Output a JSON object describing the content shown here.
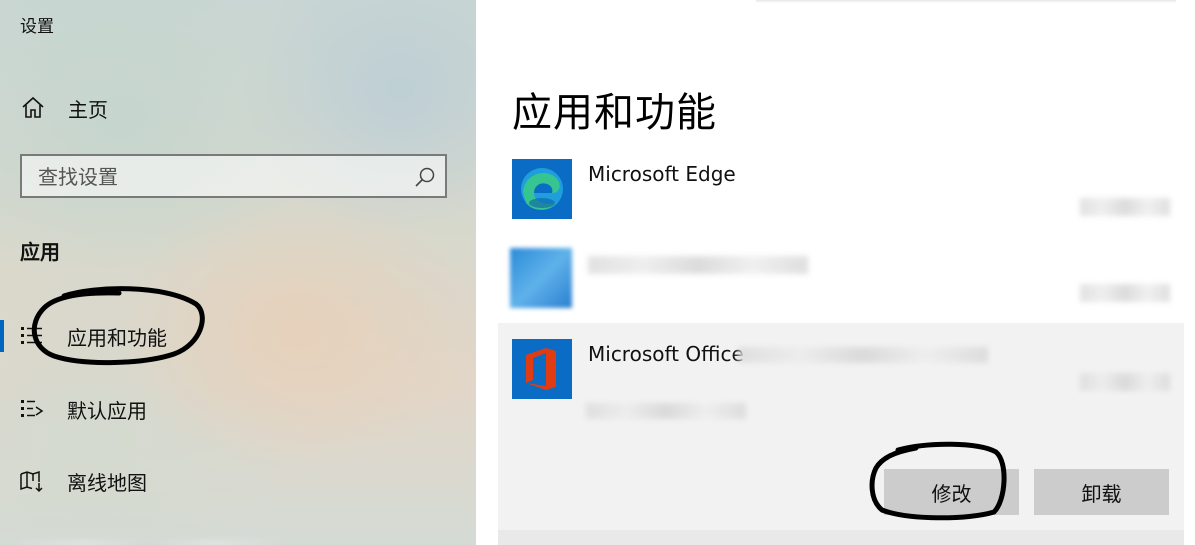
{
  "window": {
    "title": "设置"
  },
  "sidebar": {
    "home_label": "主页",
    "search_placeholder": "查找设置",
    "section_label": "应用",
    "items": [
      {
        "label": "应用和功能",
        "icon": "apps-list-icon",
        "selected": true
      },
      {
        "label": "默认应用",
        "icon": "default-apps-icon",
        "selected": false
      },
      {
        "label": "离线地图",
        "icon": "map-download-icon",
        "selected": false
      }
    ]
  },
  "main": {
    "title": "应用和功能",
    "apps": [
      {
        "name": "Microsoft Edge",
        "icon": "edge-icon"
      },
      {
        "name": "",
        "icon": "blurred-app-icon"
      },
      {
        "name": "Microsoft Office",
        "icon": "office-icon",
        "selected": true
      }
    ],
    "buttons": {
      "modify": "修改",
      "uninstall": "卸载"
    }
  },
  "colors": {
    "accent": "#0067c0",
    "button_bg": "#cccccc",
    "selected_row_bg": "#f2f2f2",
    "office_red": "#e03c13"
  }
}
